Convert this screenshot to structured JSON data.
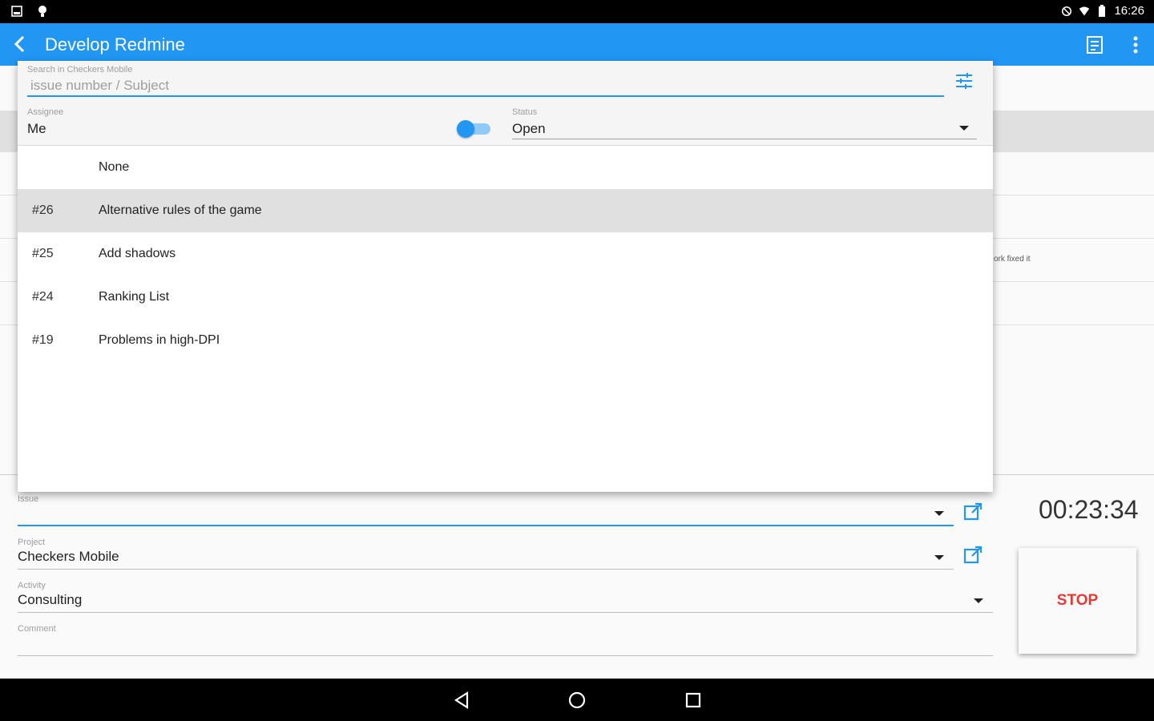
{
  "statusbar": {
    "time": "16:26"
  },
  "appbar": {
    "title": "Develop Redmine"
  },
  "background": {
    "snippet": "ork fixed it"
  },
  "search": {
    "label": "Search in Checkers Mobile",
    "placeholder": "issue number / Subject"
  },
  "assignee": {
    "label": "Assignee",
    "value": "Me",
    "toggle_on": true
  },
  "status": {
    "label": "Status",
    "value": "Open"
  },
  "issues": [
    {
      "number": "",
      "subject": "None"
    },
    {
      "number": "#26",
      "subject": "Alternative rules of the game",
      "selected": true
    },
    {
      "number": "#25",
      "subject": "Add shadows"
    },
    {
      "number": "#24",
      "subject": "Ranking List"
    },
    {
      "number": "#19",
      "subject": "Problems in high-DPI"
    }
  ],
  "form": {
    "issue": {
      "label": "Issue",
      "value": ""
    },
    "project": {
      "label": "Project",
      "value": "Checkers Mobile"
    },
    "activity": {
      "label": "Activity",
      "value": "Consulting"
    },
    "comment": {
      "label": "Comment",
      "value": ""
    }
  },
  "timer": {
    "elapsed": "00:23:34",
    "stop_label": "STOP"
  },
  "colors": {
    "accent": "#2196f3",
    "stop": "#e53935",
    "selected_row": "#e0e0e0"
  }
}
